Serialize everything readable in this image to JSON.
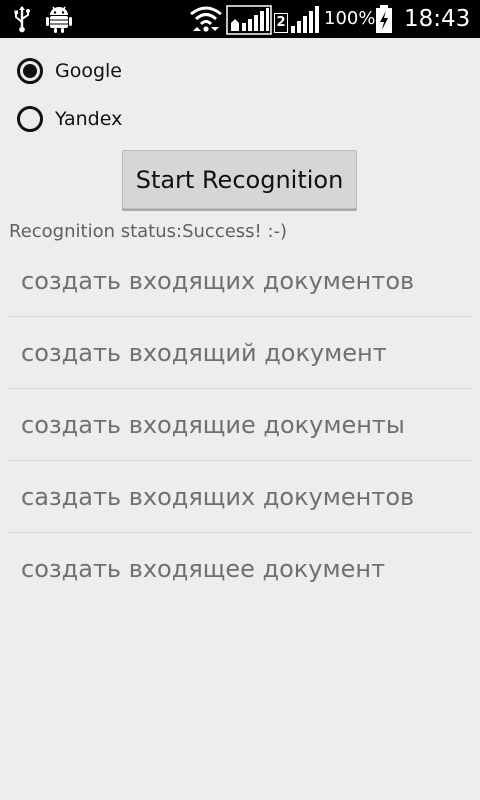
{
  "status_bar": {
    "battery_percent": "100%",
    "time": "18:43",
    "sim_slot": "2",
    "icons": [
      "usb-icon",
      "android-debug-icon",
      "wifi-icon",
      "signal-icon",
      "signal-icon",
      "battery-charging-icon"
    ]
  },
  "engines": {
    "options": [
      {
        "label": "Google",
        "selected": true
      },
      {
        "label": "Yandex",
        "selected": false
      }
    ]
  },
  "start_button": {
    "label": "Start Recognition"
  },
  "recognition_status": {
    "text": "Recognition status:Success! :-)"
  },
  "results": [
    "создать входящих документов",
    "создать входящий документ",
    "создать входящие документы",
    "саздать входящих документов",
    "создать входящее документ"
  ]
}
